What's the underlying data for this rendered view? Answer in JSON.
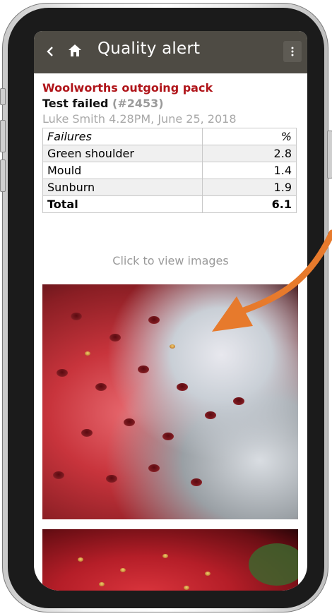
{
  "appbar": {
    "title": "Quality alert",
    "back_icon": "chevron-left-icon",
    "home_icon": "home-icon",
    "menu_icon": "more-vertical-icon"
  },
  "alert": {
    "pack_name": "Woolworths outgoing pack",
    "status_label": "Test failed",
    "test_id": "(#2453)",
    "author_time": "Luke Smith 4.28PM, June 25, 2018"
  },
  "failures_table": {
    "header": {
      "label": "Failures",
      "value": "%"
    },
    "rows": [
      {
        "label": "Green shoulder",
        "value": "2.8"
      },
      {
        "label": "Mould",
        "value": "1.4"
      },
      {
        "label": "Sunburn",
        "value": "1.9"
      }
    ],
    "total": {
      "label": "Total",
      "value": "6.1"
    }
  },
  "images": {
    "link_text": "Click to view images"
  },
  "colors": {
    "appbar": "#4e4b44",
    "pack_title": "#b0151a",
    "arrow": "#e77a2c"
  }
}
